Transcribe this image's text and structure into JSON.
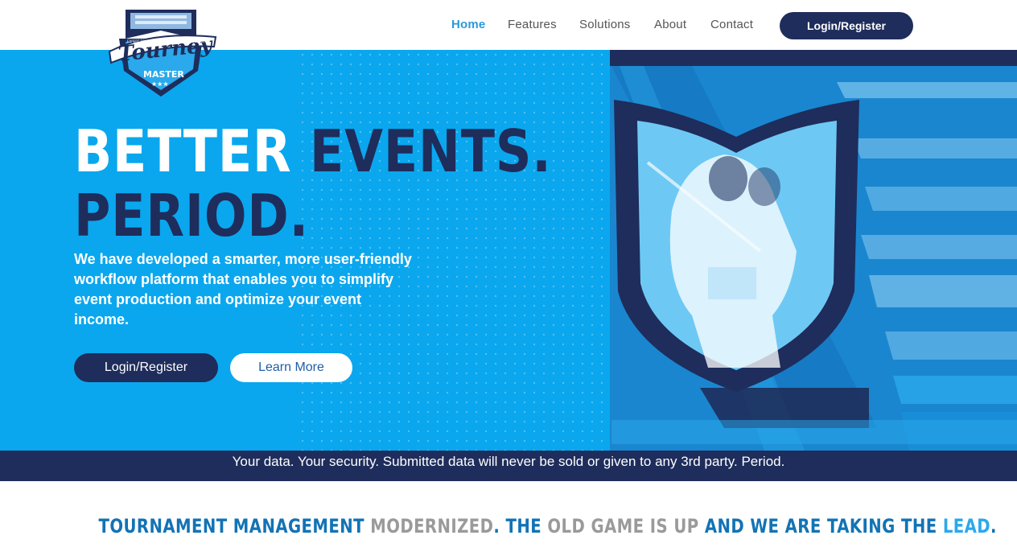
{
  "nav": {
    "items": [
      {
        "label": "Home",
        "active": true
      },
      {
        "label": "Features",
        "active": false
      },
      {
        "label": "Solutions",
        "active": false
      },
      {
        "label": "About",
        "active": false
      },
      {
        "label": "Contact",
        "active": false
      }
    ],
    "cta_label": "Login/Register"
  },
  "logo": {
    "name": "Tourney",
    "sub": "MASTER",
    "banner": "EXPERT TOURNAMENT PRODUCTION MADE EASY"
  },
  "hero": {
    "headline_part1": "BETTER ",
    "headline_part2": "EVENTS.",
    "headline_line2": "PERIOD.",
    "body": "We have developed a smarter, more user-friendly workflow platform that enables you to simplify event production and optimize your event income.",
    "primary_button": "Login/Register",
    "secondary_button": "Learn More",
    "image_icon": "lacrosse-players-shield-image"
  },
  "privacy_notice": "Your data. Your security. Submitted data will never be sold or given to any 3rd party. Period.",
  "tagline": {
    "part1": "TOURNAMENT MANAGEMENT ",
    "part2": "MODERNIZED",
    "part3": ". THE ",
    "part4": "OLD GAME IS UP",
    "part5": " AND WE ARE TAKING THE ",
    "part6": "LEAD",
    "part7": "."
  },
  "colors": {
    "brand_navy": "#1e2d5b",
    "hero_blue": "#0aa7ee",
    "nav_active": "#2b9ad9",
    "tagline_blue": "#1273b5",
    "tagline_gray": "#9a9a9a",
    "tagline_light": "#2aa9ec"
  }
}
